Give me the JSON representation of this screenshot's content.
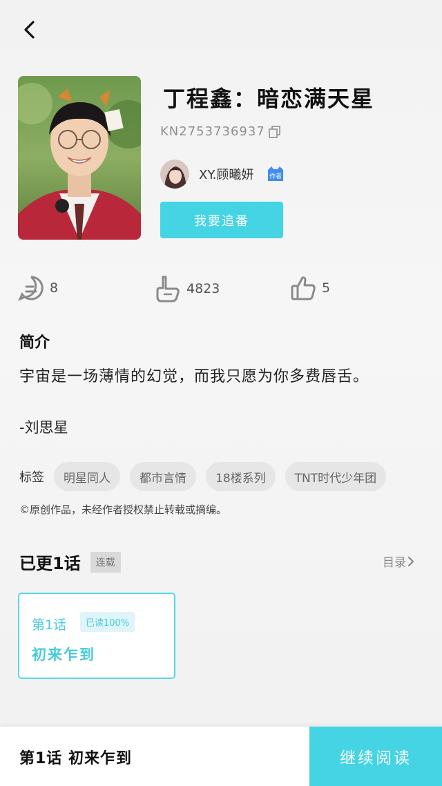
{
  "header": {
    "back_icon": "chevron-left-icon"
  },
  "book": {
    "title": "丁程鑫：暗恋满天星",
    "id": "KN2753736937",
    "author": {
      "name": "XY.顾曦妍",
      "badge": "作者"
    },
    "follow_label": "我要追番"
  },
  "stats": [
    {
      "icon": "comment-icon",
      "value": "8"
    },
    {
      "icon": "poke-icon",
      "value": "4823"
    },
    {
      "icon": "thumbs-up-icon",
      "value": "5"
    }
  ],
  "intro": {
    "title": "简介",
    "text": "宇宙是一场薄情的幻觉，而我只愿为你多费唇舌。",
    "signature": "-刘思星"
  },
  "tags": {
    "label": "标签",
    "items": [
      "明星同人",
      "都市言情",
      "18楼系列",
      "TNT时代少年团"
    ]
  },
  "copyright": "©原创作品，未经作者授权禁止转载或摘编。",
  "chapters": {
    "count_label": "已更1话",
    "status": "连载",
    "catalog_label": "目录",
    "items": [
      {
        "number": "第1话",
        "progress": "已读100%",
        "name": "初来乍到"
      }
    ]
  },
  "bottom_bar": {
    "current_chapter": "第1话 初来乍到",
    "continue_label": "继续阅读"
  },
  "colors": {
    "accent": "#44d4e4",
    "accent_text": "#44cbdb"
  }
}
